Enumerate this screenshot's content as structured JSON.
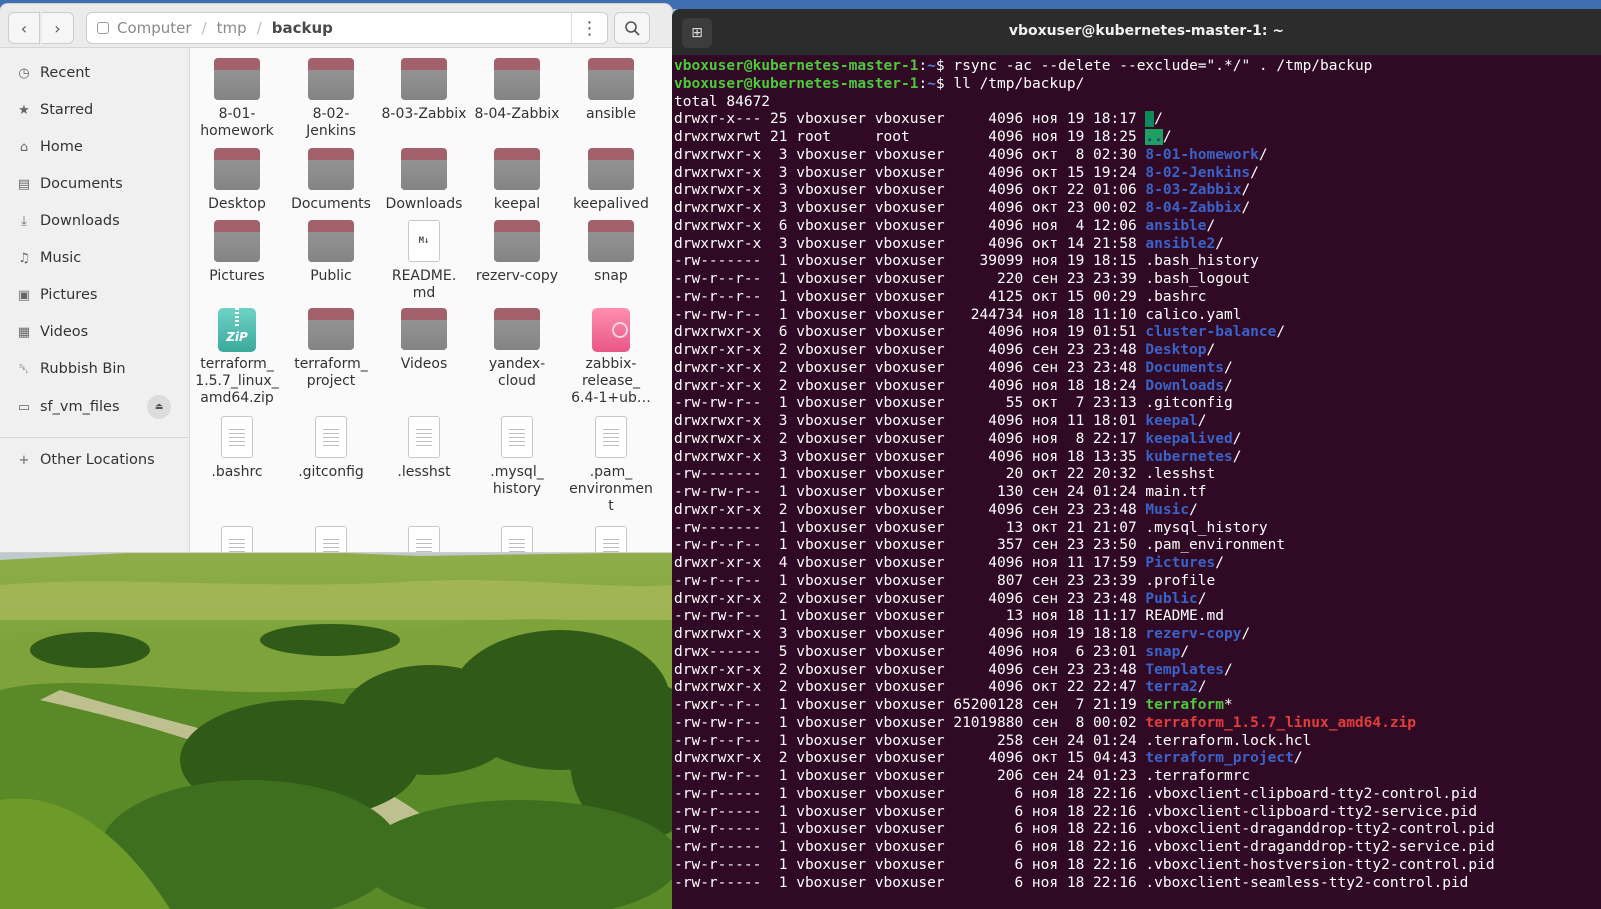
{
  "file_manager": {
    "breadcrumb": [
      "Computer",
      "tmp",
      "backup"
    ],
    "sidebar": [
      {
        "label": "Recent",
        "icon": "clock-icon"
      },
      {
        "label": "Starred",
        "icon": "star-icon"
      },
      {
        "label": "Home",
        "icon": "home-icon"
      },
      {
        "label": "Documents",
        "icon": "document-icon"
      },
      {
        "label": "Downloads",
        "icon": "download-icon"
      },
      {
        "label": "Music",
        "icon": "music-icon"
      },
      {
        "label": "Pictures",
        "icon": "picture-icon"
      },
      {
        "label": "Videos",
        "icon": "video-icon"
      },
      {
        "label": "Rubbish Bin",
        "icon": "trash-icon"
      },
      {
        "label": "sf_vm_files",
        "icon": "drive-icon"
      }
    ],
    "other_locations": "Other Locations",
    "items": [
      {
        "name": "8-01-\nhomework",
        "type": "folder"
      },
      {
        "name": "8-02-\nJenkins",
        "type": "folder"
      },
      {
        "name": "8-03-Zabbix",
        "type": "folder"
      },
      {
        "name": "8-04-Zabbix",
        "type": "folder"
      },
      {
        "name": "ansible",
        "type": "folder"
      },
      {
        "name": "Desktop",
        "type": "folder"
      },
      {
        "name": "Documents",
        "type": "folder"
      },
      {
        "name": "Downloads",
        "type": "folder"
      },
      {
        "name": "keepal",
        "type": "folder"
      },
      {
        "name": "keepalived",
        "type": "folder"
      },
      {
        "name": "Pictures",
        "type": "folder"
      },
      {
        "name": "Public",
        "type": "folder"
      },
      {
        "name": "README.\nmd",
        "type": "markdown"
      },
      {
        "name": "rezerv-copy",
        "type": "folder"
      },
      {
        "name": "snap",
        "type": "folder"
      },
      {
        "name": "terraform_\n1.5.7_linux_\namd64.zip",
        "type": "zip"
      },
      {
        "name": "terraform_\nproject",
        "type": "folder"
      },
      {
        "name": "Videos",
        "type": "folder"
      },
      {
        "name": "yandex-\ncloud",
        "type": "folder"
      },
      {
        "name": "zabbix-\nrelease_\n6.4-1+ub…",
        "type": "deb"
      },
      {
        "name": ".bashrc",
        "type": "text"
      },
      {
        "name": ".gitconfig",
        "type": "text"
      },
      {
        "name": ".lesshst",
        "type": "text"
      },
      {
        "name": ".mysql_\nhistory",
        "type": "text"
      },
      {
        "name": ".pam_\nenvironmen\nt",
        "type": "text"
      }
    ]
  },
  "terminal": {
    "title": "vboxuser@kubernetes-master-1: ~",
    "prompts": [
      {
        "user": "vboxuser@kubernetes-master-1",
        "path": "~",
        "command": "rsync -ac --delete --exclude=\".*/\" . /tmp/backup"
      },
      {
        "user": "vboxuser@kubernetes-master-1",
        "path": "~",
        "command": "ll /tmp/backup/"
      }
    ],
    "total_line": "total 84672",
    "listing": [
      {
        "meta": "drwxr-x--- 25 vboxuser vboxuser     4096 ноя 19 18:17 ",
        "name": ".",
        "suffix": "/",
        "style": "dirhl"
      },
      {
        "meta": "drwxrwxrwt 21 root     root         4096 ноя 19 18:25 ",
        "name": "..",
        "suffix": "/",
        "style": "dirhl2"
      },
      {
        "meta": "drwxrwxr-x  3 vboxuser vboxuser     4096 окт  8 02:30 ",
        "name": "8-01-homework",
        "suffix": "/",
        "style": "dir"
      },
      {
        "meta": "drwxrwxr-x  3 vboxuser vboxuser     4096 окт 15 19:24 ",
        "name": "8-02-Jenkins",
        "suffix": "/",
        "style": "dir"
      },
      {
        "meta": "drwxrwxr-x  3 vboxuser vboxuser     4096 окт 22 01:06 ",
        "name": "8-03-Zabbix",
        "suffix": "/",
        "style": "dir"
      },
      {
        "meta": "drwxrwxr-x  3 vboxuser vboxuser     4096 окт 23 00:02 ",
        "name": "8-04-Zabbix",
        "suffix": "/",
        "style": "dir"
      },
      {
        "meta": "drwxrwxr-x  6 vboxuser vboxuser     4096 ноя  4 12:06 ",
        "name": "ansible",
        "suffix": "/",
        "style": "dir"
      },
      {
        "meta": "drwxrwxr-x  3 vboxuser vboxuser     4096 окт 14 21:58 ",
        "name": "ansible2",
        "suffix": "/",
        "style": "dir"
      },
      {
        "meta": "-rw-------  1 vboxuser vboxuser    39099 ноя 19 18:15 ",
        "name": ".bash_history",
        "suffix": "",
        "style": "plain"
      },
      {
        "meta": "-rw-r--r--  1 vboxuser vboxuser      220 сен 23 23:39 ",
        "name": ".bash_logout",
        "suffix": "",
        "style": "plain"
      },
      {
        "meta": "-rw-r--r--  1 vboxuser vboxuser     4125 окт 15 00:29 ",
        "name": ".bashrc",
        "suffix": "",
        "style": "plain"
      },
      {
        "meta": "-rw-rw-r--  1 vboxuser vboxuser   244734 ноя 18 11:10 ",
        "name": "calico.yaml",
        "suffix": "",
        "style": "plain"
      },
      {
        "meta": "drwxrwxr-x  6 vboxuser vboxuser     4096 ноя 19 01:51 ",
        "name": "cluster-balance",
        "suffix": "/",
        "style": "dir"
      },
      {
        "meta": "drwxr-xr-x  2 vboxuser vboxuser     4096 сен 23 23:48 ",
        "name": "Desktop",
        "suffix": "/",
        "style": "dir"
      },
      {
        "meta": "drwxr-xr-x  2 vboxuser vboxuser     4096 сен 23 23:48 ",
        "name": "Documents",
        "suffix": "/",
        "style": "dir"
      },
      {
        "meta": "drwxr-xr-x  2 vboxuser vboxuser     4096 ноя 18 18:24 ",
        "name": "Downloads",
        "suffix": "/",
        "style": "dir"
      },
      {
        "meta": "-rw-rw-r--  1 vboxuser vboxuser       55 окт  7 23:13 ",
        "name": ".gitconfig",
        "suffix": "",
        "style": "plain"
      },
      {
        "meta": "drwxrwxr-x  3 vboxuser vboxuser     4096 ноя 11 18:01 ",
        "name": "keepal",
        "suffix": "/",
        "style": "dir"
      },
      {
        "meta": "drwxrwxr-x  2 vboxuser vboxuser     4096 ноя  8 22:17 ",
        "name": "keepalived",
        "suffix": "/",
        "style": "dir"
      },
      {
        "meta": "drwxrwxr-x  3 vboxuser vboxuser     4096 ноя 18 13:35 ",
        "name": "kubernetes",
        "suffix": "/",
        "style": "dir"
      },
      {
        "meta": "-rw-------  1 vboxuser vboxuser       20 окт 22 20:32 ",
        "name": ".lesshst",
        "suffix": "",
        "style": "plain"
      },
      {
        "meta": "-rw-rw-r--  1 vboxuser vboxuser      130 сен 24 01:24 ",
        "name": "main.tf",
        "suffix": "",
        "style": "plain"
      },
      {
        "meta": "drwxr-xr-x  2 vboxuser vboxuser     4096 сен 23 23:48 ",
        "name": "Music",
        "suffix": "/",
        "style": "dir"
      },
      {
        "meta": "-rw-------  1 vboxuser vboxuser       13 окт 21 21:07 ",
        "name": ".mysql_history",
        "suffix": "",
        "style": "plain"
      },
      {
        "meta": "-rw-r--r--  1 vboxuser vboxuser      357 сен 23 23:50 ",
        "name": ".pam_environment",
        "suffix": "",
        "style": "plain"
      },
      {
        "meta": "drwxr-xr-x  4 vboxuser vboxuser     4096 ноя 11 17:59 ",
        "name": "Pictures",
        "suffix": "/",
        "style": "dir"
      },
      {
        "meta": "-rw-r--r--  1 vboxuser vboxuser      807 сен 23 23:39 ",
        "name": ".profile",
        "suffix": "",
        "style": "plain"
      },
      {
        "meta": "drwxr-xr-x  2 vboxuser vboxuser     4096 сен 23 23:48 ",
        "name": "Public",
        "suffix": "/",
        "style": "dir"
      },
      {
        "meta": "-rw-rw-r--  1 vboxuser vboxuser       13 ноя 18 11:17 ",
        "name": "README.md",
        "suffix": "",
        "style": "plain"
      },
      {
        "meta": "drwxrwxr-x  3 vboxuser vboxuser     4096 ноя 19 18:18 ",
        "name": "rezerv-copy",
        "suffix": "/",
        "style": "dir"
      },
      {
        "meta": "drwx------  5 vboxuser vboxuser     4096 ноя  6 23:01 ",
        "name": "snap",
        "suffix": "/",
        "style": "dir"
      },
      {
        "meta": "drwxr-xr-x  2 vboxuser vboxuser     4096 сен 23 23:48 ",
        "name": "Templates",
        "suffix": "/",
        "style": "dir"
      },
      {
        "meta": "drwxrwxr-x  2 vboxuser vboxuser     4096 окт 22 22:47 ",
        "name": "terra2",
        "suffix": "/",
        "style": "dir"
      },
      {
        "meta": "-rwxr--r--  1 vboxuser vboxuser 65200128 сен  7 21:19 ",
        "name": "terraform",
        "suffix": "*",
        "style": "exe"
      },
      {
        "meta": "-rw-rw-r--  1 vboxuser vboxuser 21019880 сен  8 00:02 ",
        "name": "terraform_1.5.7_linux_amd64.zip",
        "suffix": "",
        "style": "zip"
      },
      {
        "meta": "-rw-r--r--  1 vboxuser vboxuser      258 сен 24 01:24 ",
        "name": ".terraform.lock.hcl",
        "suffix": "",
        "style": "plain"
      },
      {
        "meta": "drwxrwxr-x  2 vboxuser vboxuser     4096 окт 15 04:43 ",
        "name": "terraform_project",
        "suffix": "/",
        "style": "dir"
      },
      {
        "meta": "-rw-rw-r--  1 vboxuser vboxuser      206 сен 24 01:23 ",
        "name": ".terraformrc",
        "suffix": "",
        "style": "plain"
      },
      {
        "meta": "-rw-r-----  1 vboxuser vboxuser        6 ноя 18 22:16 ",
        "name": ".vboxclient-clipboard-tty2-control.pid",
        "suffix": "",
        "style": "plain"
      },
      {
        "meta": "-rw-r-----  1 vboxuser vboxuser        6 ноя 18 22:16 ",
        "name": ".vboxclient-clipboard-tty2-service.pid",
        "suffix": "",
        "style": "plain"
      },
      {
        "meta": "-rw-r-----  1 vboxuser vboxuser        6 ноя 18 22:16 ",
        "name": ".vboxclient-draganddrop-tty2-control.pid",
        "suffix": "",
        "style": "plain"
      },
      {
        "meta": "-rw-r-----  1 vboxuser vboxuser        6 ноя 18 22:16 ",
        "name": ".vboxclient-draganddrop-tty2-service.pid",
        "suffix": "",
        "style": "plain"
      },
      {
        "meta": "-rw-r-----  1 vboxuser vboxuser        6 ноя 18 22:16 ",
        "name": ".vboxclient-hostversion-tty2-control.pid",
        "suffix": "",
        "style": "plain"
      },
      {
        "meta": "-rw-r-----  1 vboxuser vboxuser        6 ноя 18 22:16 ",
        "name": ".vboxclient-seamless-tty2-control.pid",
        "suffix": "",
        "style": "plain"
      }
    ]
  }
}
